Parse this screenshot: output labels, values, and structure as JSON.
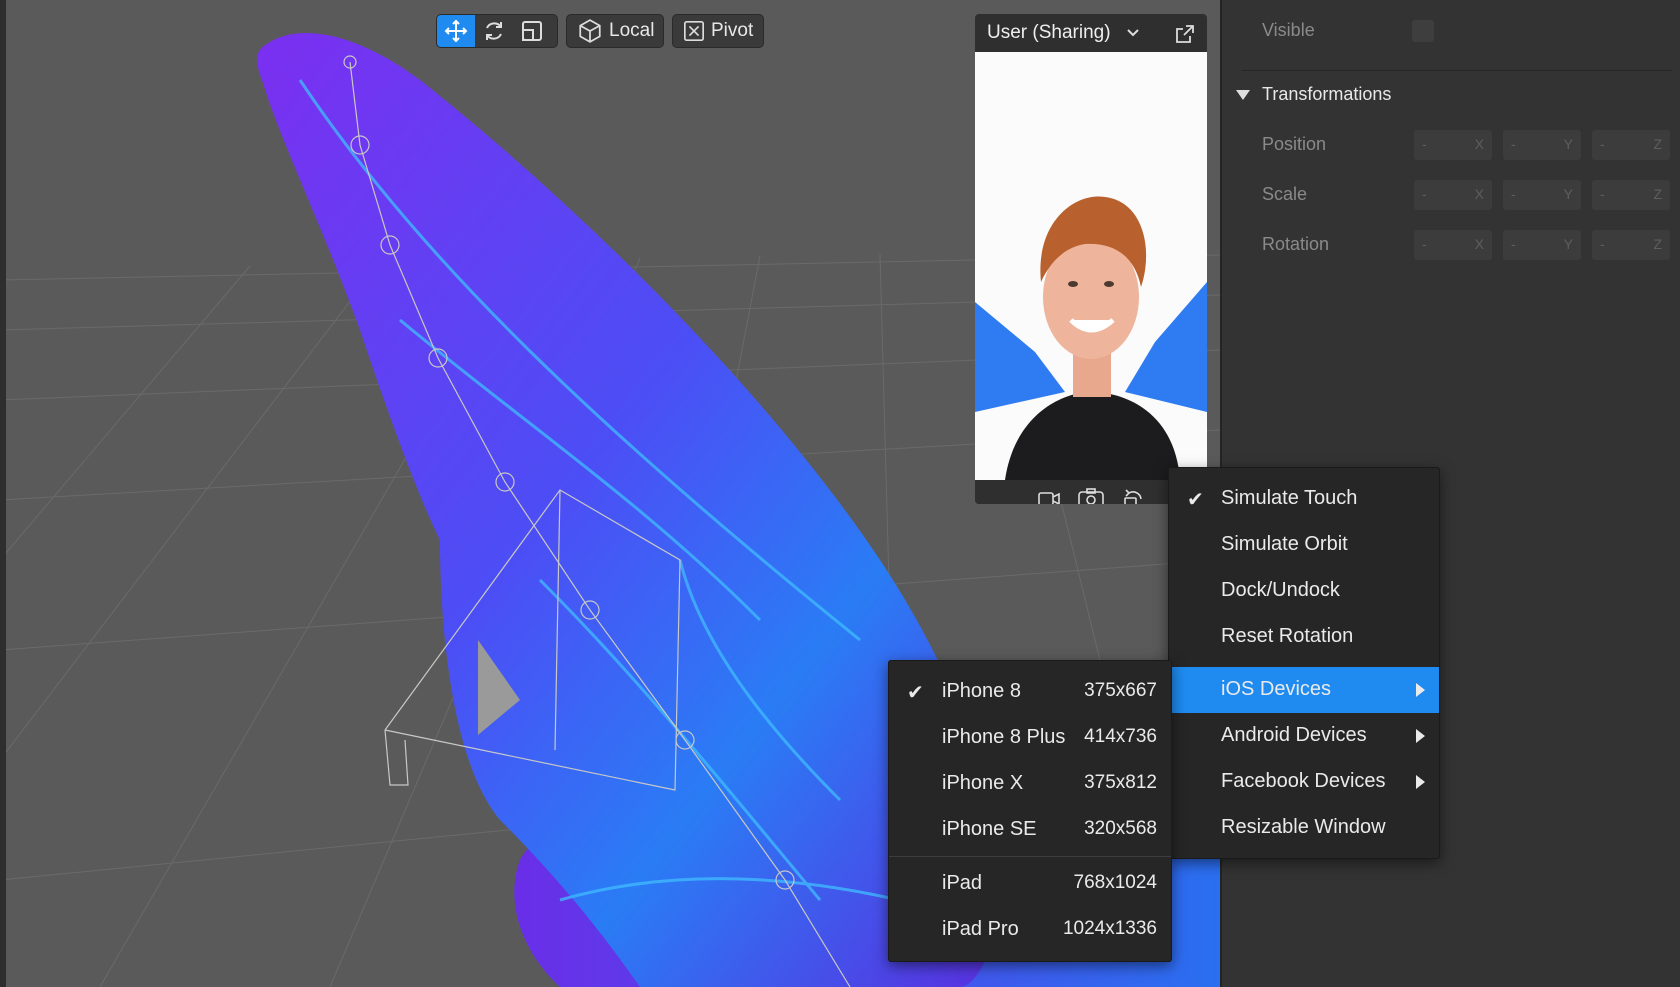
{
  "toolbar": {
    "local_label": "Local",
    "pivot_label": "Pivot"
  },
  "preview": {
    "title": "User (Sharing)"
  },
  "inspector": {
    "visible_label": "Visible",
    "transformations_label": "Transformations",
    "rows": [
      {
        "label": "Position",
        "axes": [
          "X",
          "Y",
          "Z"
        ]
      },
      {
        "label": "Scale",
        "axes": [
          "X",
          "Y",
          "Z"
        ]
      },
      {
        "label": "Rotation",
        "axes": [
          "X",
          "Y",
          "Z"
        ]
      }
    ],
    "placeholder": "-"
  },
  "context_menu": {
    "items": [
      {
        "label": "Simulate Touch",
        "checked": true
      },
      {
        "label": "Simulate Orbit"
      },
      {
        "label": "Dock/Undock"
      },
      {
        "label": "Reset Rotation"
      },
      {
        "label": "iOS Devices",
        "submenu": true,
        "highlighted": true
      },
      {
        "label": "Android Devices",
        "submenu": true
      },
      {
        "label": "Facebook Devices",
        "submenu": true
      },
      {
        "label": "Resizable Window"
      }
    ]
  },
  "device_menu": {
    "items": [
      {
        "label": "iPhone 8",
        "size": "375x667",
        "checked": true
      },
      {
        "label": "iPhone 8 Plus",
        "size": "414x736"
      },
      {
        "label": "iPhone X",
        "size": "375x812"
      },
      {
        "label": "iPhone SE",
        "size": "320x568"
      },
      {
        "label": "iPad",
        "size": "768x1024"
      },
      {
        "label": "iPad Pro",
        "size": "1024x1336"
      }
    ]
  },
  "colors": {
    "accent": "#1f8bf0",
    "wing": "#5a3df0",
    "panel": "#333333"
  }
}
